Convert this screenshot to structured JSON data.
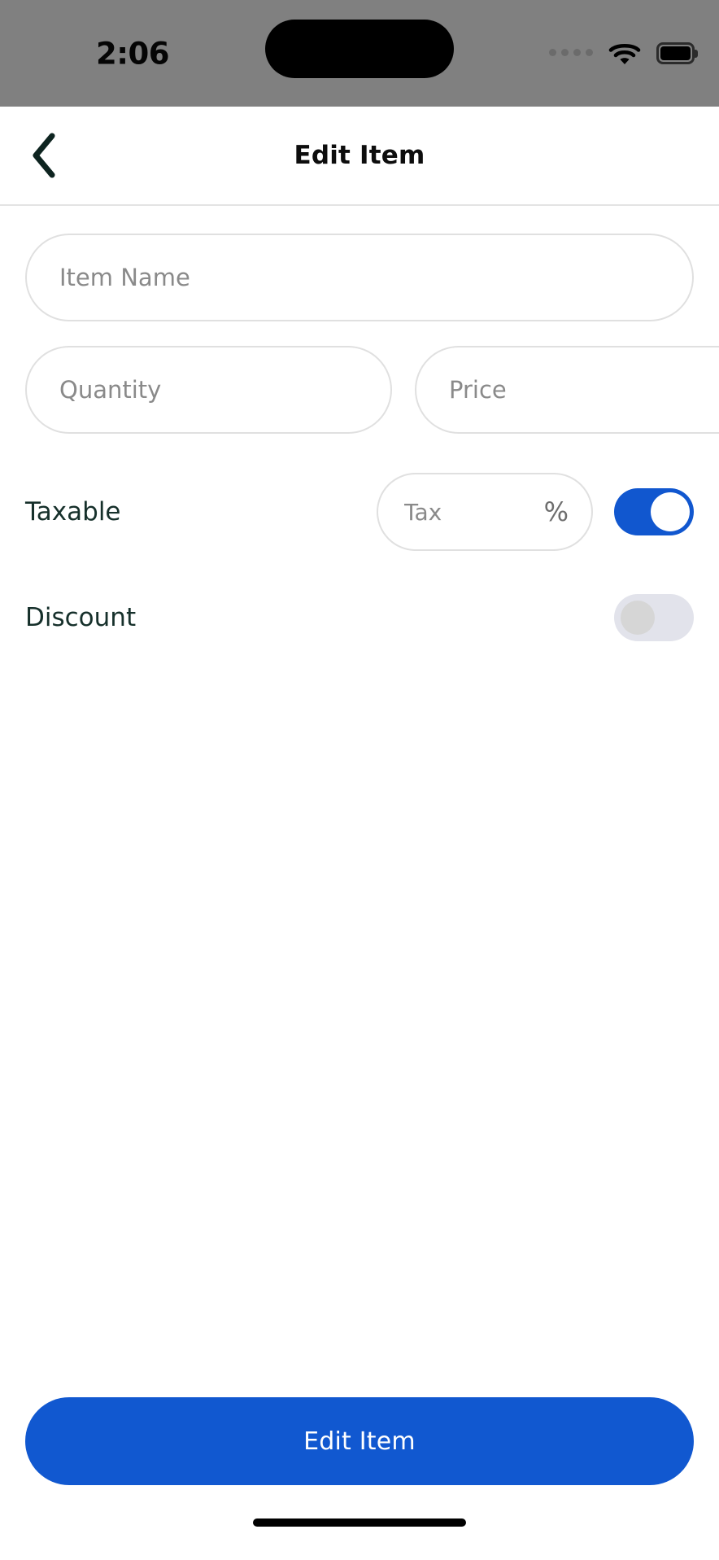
{
  "status_bar": {
    "time": "2:06",
    "signal_icon": "signal-dots-icon",
    "wifi_icon": "wifi-icon",
    "battery_icon": "battery-full-icon",
    "background_color": "#808080"
  },
  "header": {
    "back_icon": "chevron-left-icon",
    "title": "Edit Item",
    "title_color": "#0d0d0d",
    "divider_color": "#e3e3e3"
  },
  "form": {
    "item_name": {
      "placeholder": "Item Name",
      "value": ""
    },
    "quantity": {
      "placeholder": "Quantity",
      "value": ""
    },
    "price": {
      "placeholder": "Price",
      "value": ""
    },
    "taxable": {
      "label": "Taxable",
      "tax_placeholder": "Tax",
      "tax_value": "",
      "percent_symbol": "%",
      "toggle_state": "on",
      "toggle_on_color": "#1157cf"
    },
    "discount": {
      "label": "Discount",
      "toggle_state": "off",
      "toggle_off_color": "#e2e3eb"
    }
  },
  "footer": {
    "submit_label": "Edit Item",
    "submit_color": "#1158d0"
  }
}
